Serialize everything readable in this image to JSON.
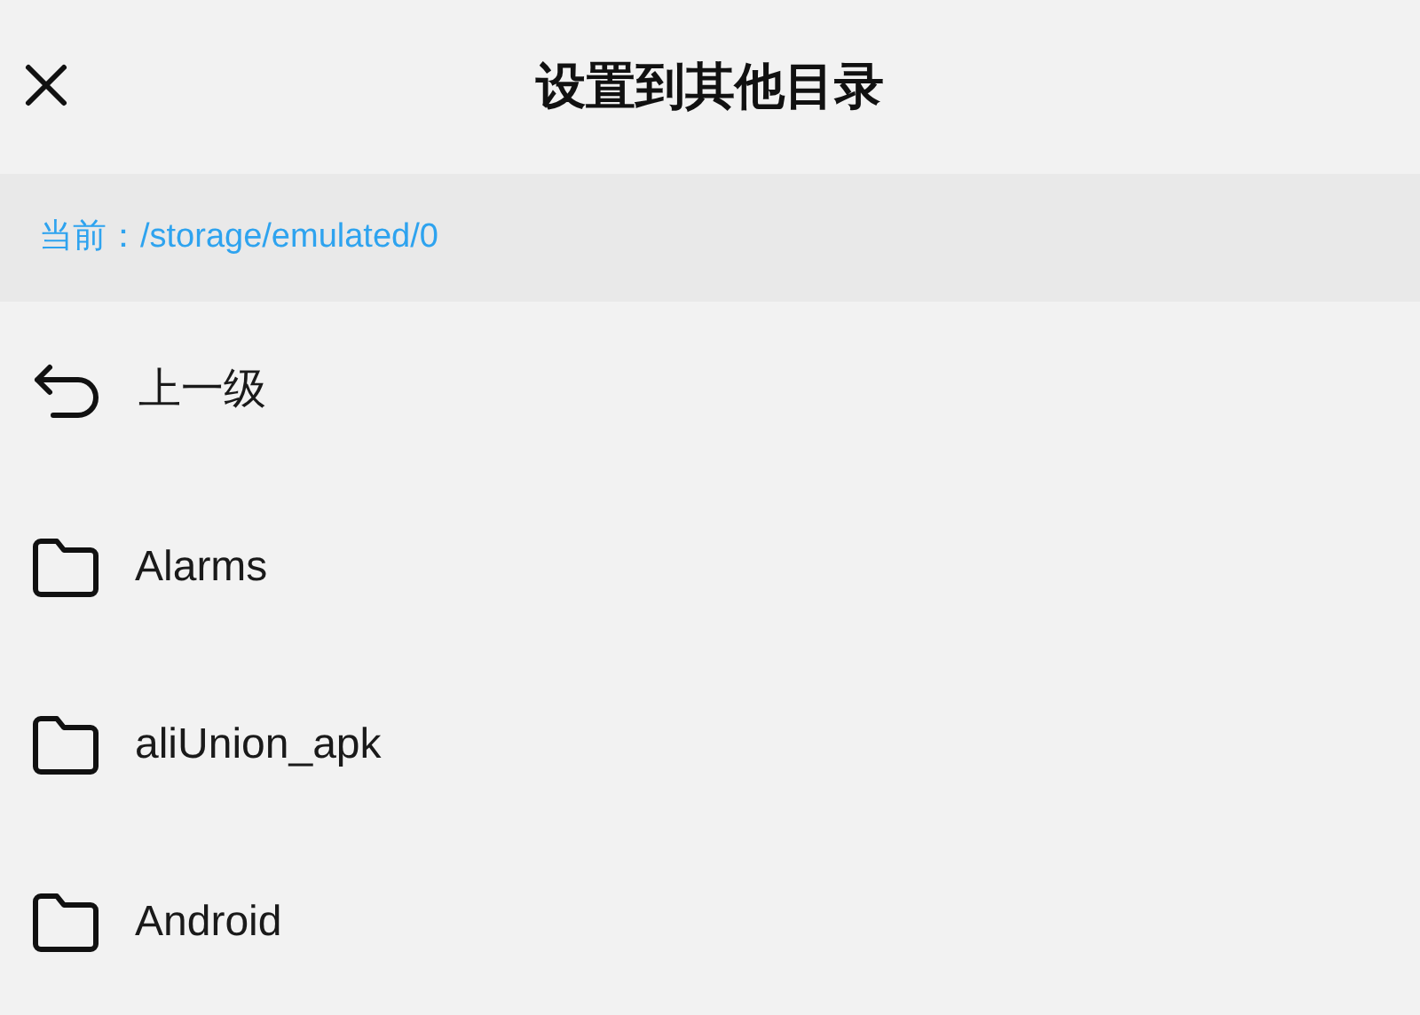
{
  "header": {
    "title": "设置到其他目录"
  },
  "path_bar": {
    "text": "当前：/storage/emulated/0"
  },
  "entries": [
    {
      "kind": "parent",
      "label": "上一级"
    },
    {
      "kind": "folder",
      "label": "Alarms"
    },
    {
      "kind": "folder",
      "label": "aliUnion_apk"
    },
    {
      "kind": "folder",
      "label": "Android"
    }
  ]
}
